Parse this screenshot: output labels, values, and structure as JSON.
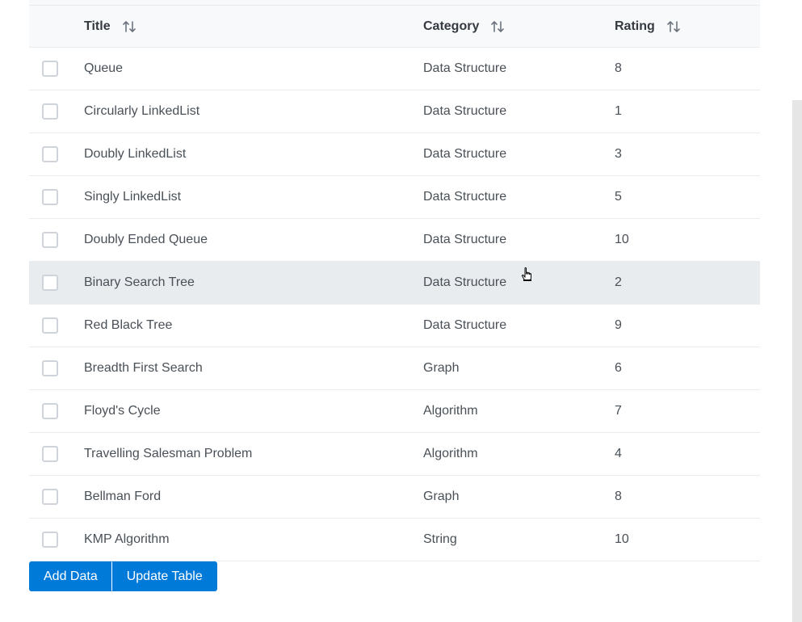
{
  "table": {
    "headers": {
      "title": "Title",
      "category": "Category",
      "rating": "Rating"
    },
    "rows": [
      {
        "title": "Queue",
        "category": "Data Structure",
        "rating": "8"
      },
      {
        "title": "Circularly LinkedList",
        "category": "Data Structure",
        "rating": "1"
      },
      {
        "title": "Doubly LinkedList",
        "category": "Data Structure",
        "rating": "3"
      },
      {
        "title": "Singly LinkedList",
        "category": "Data Structure",
        "rating": "5"
      },
      {
        "title": "Doubly Ended Queue",
        "category": "Data Structure",
        "rating": "10"
      },
      {
        "title": "Binary Search Tree",
        "category": "Data Structure",
        "rating": "2"
      },
      {
        "title": "Red Black Tree",
        "category": "Data Structure",
        "rating": "9"
      },
      {
        "title": "Breadth First Search",
        "category": "Graph",
        "rating": "6"
      },
      {
        "title": "Floyd's Cycle",
        "category": "Algorithm",
        "rating": "7"
      },
      {
        "title": "Travelling Salesman Problem",
        "category": "Algorithm",
        "rating": "4"
      },
      {
        "title": "Bellman Ford",
        "category": "Graph",
        "rating": "8"
      },
      {
        "title": "KMP Algorithm",
        "category": "String",
        "rating": "10"
      }
    ],
    "hovered_row": 5
  },
  "actions": {
    "add_label": "Add Data",
    "update_label": "Update Table"
  },
  "colors": {
    "primary": "#007ad9",
    "header_bg": "#f8f9fa",
    "hover_bg": "#e9ecef"
  },
  "icons": {
    "sort": "sort-arrows-icon",
    "checkbox": "checkbox-unchecked",
    "cursor": "hand-pointer-icon"
  }
}
